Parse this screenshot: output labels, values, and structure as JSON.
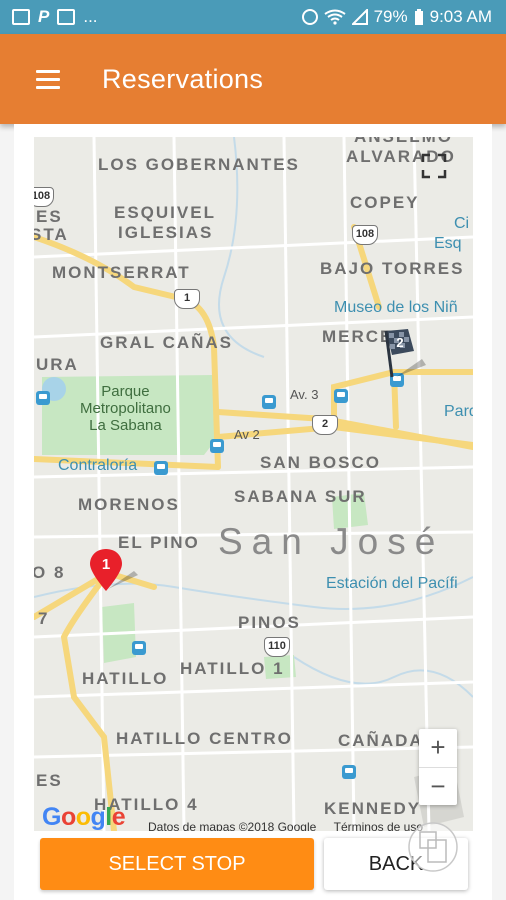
{
  "status_bar": {
    "left_icons": [
      "image-icon",
      "pinterest-icon",
      "email-icon"
    ],
    "overflow": "...",
    "battery": "79%",
    "time": "9:03 AM"
  },
  "app_bar": {
    "title": "Reservations",
    "menu_icon": "hamburger-menu-icon"
  },
  "map": {
    "labels": {
      "anselmo": "ANSELMO",
      "alvarado": "ALVARADO",
      "los_gobernantes": "LOS GOBERNANTES",
      "es": "ES",
      "sta": "STA",
      "esquivel": "ESQUIVEL",
      "iglesias": "IGLESIAS",
      "copey": "COPEY",
      "ci": "Ci",
      "esq": "Esq",
      "montserrat": "MONTSERRAT",
      "bajo_torres": "BAJO TORRES",
      "museo": "Museo de los Niñ",
      "merced": "MERCED",
      "gral_canas": "GRAL CAÑAS",
      "ura": "URA",
      "parque_line1": "Parque",
      "parque_line2": "Metropolitano",
      "parque_line3": "La Sabana",
      "av3": "Av. 3",
      "av2": "Av 2",
      "parq_right": "Parq",
      "contraloria": "Contraloría",
      "san_bosco": "SAN BOSCO",
      "morenos": "MORENOS",
      "sabana_sur": "SABANA SUR",
      "el_pino": "EL PINO",
      "san_jose": "San José",
      "o8": "O 8",
      "estacion": "Estación del Pacífi",
      "seven": "7",
      "pinos": "PINOS",
      "hatillo_1": "HATILLO 1",
      "hatillo": "HATILLO",
      "hatillo_centro": "HATILLO CENTRO",
      "canada": "CAÑADA",
      "es_bottom": "ES",
      "hatillo_4": "HATILLO 4",
      "kennedy": "KENNEDY"
    },
    "route_shields": {
      "r108_top": "108",
      "r108_left": "108",
      "r1": "1",
      "r2": "2",
      "r110": "110"
    },
    "markers": [
      {
        "label": "1",
        "icon": "red-pin-icon",
        "color": "#e8202a"
      },
      {
        "label": "2",
        "icon": "checkered-flag-icon",
        "color": "#3c4a5c"
      }
    ],
    "zoom_in": "+",
    "zoom_out": "−",
    "google_logo": [
      "G",
      "o",
      "o",
      "g",
      "l",
      "e"
    ],
    "attribution": "Datos de mapas ©2018 Google",
    "terms": "Términos de uso"
  },
  "buttons": {
    "select_stop": "SELECT STOP",
    "back": "BACK"
  },
  "colors": {
    "status_bar": "#4a9bb8",
    "app_bar": "#e67e32",
    "primary_button": "#ff8c14",
    "marker_red": "#e8202a",
    "map_road_major": "#f6d77c",
    "map_park": "#c7e7c2"
  }
}
